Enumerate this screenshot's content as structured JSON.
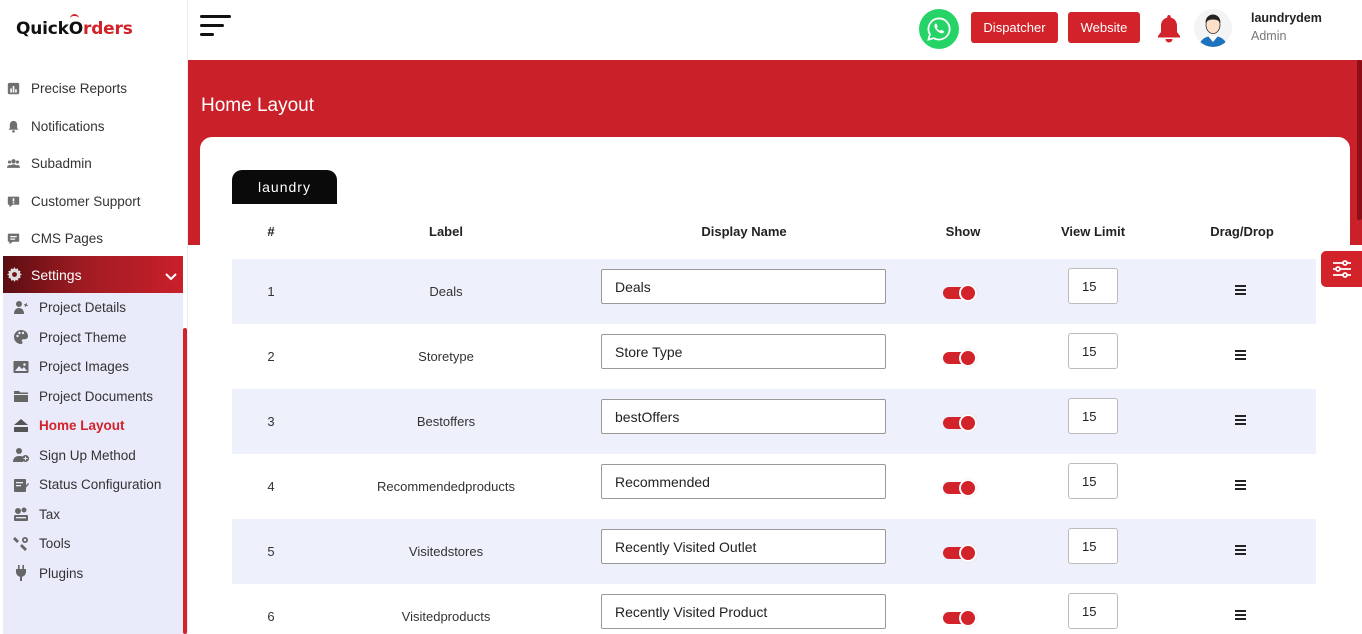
{
  "logo": {
    "part1": "Quick",
    "part2": "rders",
    "o": "O"
  },
  "sidebar": {
    "items": [
      {
        "label": "Precise Reports",
        "icon": "report-icon"
      },
      {
        "label": "Notifications",
        "icon": "bell-icon"
      },
      {
        "label": "Subadmin",
        "icon": "users-icon"
      },
      {
        "label": "Customer Support",
        "icon": "support-icon"
      },
      {
        "label": "CMS Pages",
        "icon": "cms-icon"
      }
    ],
    "settings": {
      "label": "Settings",
      "icon": "gear-icon"
    },
    "subitems": [
      {
        "label": "Project Details",
        "icon": "project-details-icon"
      },
      {
        "label": "Project Theme",
        "icon": "palette-icon"
      },
      {
        "label": "Project Images",
        "icon": "image-icon"
      },
      {
        "label": "Project Documents",
        "icon": "folder-icon"
      },
      {
        "label": "Home Layout",
        "icon": "home-icon",
        "active": true
      },
      {
        "label": "Sign Up Method",
        "icon": "user-add-icon"
      },
      {
        "label": "Status Configuration",
        "icon": "status-icon"
      },
      {
        "label": "Tax",
        "icon": "tax-icon"
      },
      {
        "label": "Tools",
        "icon": "tools-icon"
      },
      {
        "label": "Plugins",
        "icon": "plug-icon"
      }
    ]
  },
  "header": {
    "dispatcher_label": "Dispatcher",
    "website_label": "Website",
    "user_name": "laundrydem",
    "user_role": "Admin"
  },
  "page": {
    "title": "Home Layout",
    "tab_label": "laundry"
  },
  "table": {
    "headers": {
      "num": "#",
      "label": "Label",
      "display": "Display Name",
      "show": "Show",
      "limit": "View Limit",
      "drag": "Drag/Drop"
    },
    "rows": [
      {
        "num": "1",
        "label": "Deals",
        "display": "Deals",
        "show": true,
        "limit": "15"
      },
      {
        "num": "2",
        "label": "Storetype",
        "display": "Store Type",
        "show": true,
        "limit": "15"
      },
      {
        "num": "3",
        "label": "Bestoffers",
        "display": "bestOffers",
        "show": true,
        "limit": "15"
      },
      {
        "num": "4",
        "label": "Recommendedproducts",
        "display": "Recommended",
        "show": true,
        "limit": "15"
      },
      {
        "num": "5",
        "label": "Visitedstores",
        "display": "Recently Visited Outlet",
        "show": true,
        "limit": "15"
      },
      {
        "num": "6",
        "label": "Visitedproducts",
        "display": "Recently Visited Product",
        "show": true,
        "limit": "15"
      }
    ]
  },
  "colors": {
    "accent": "#d2232a",
    "whatsapp": "#25d366",
    "subnav_bg": "#e9ebfa",
    "row_shade": "#eef0fb"
  }
}
